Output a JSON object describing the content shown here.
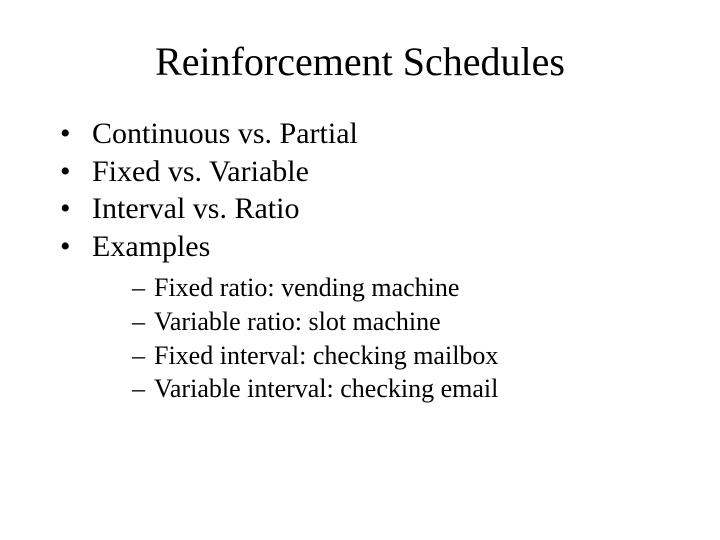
{
  "title": "Reinforcement Schedules",
  "bullets": {
    "0": "Continuous vs. Partial",
    "1": "Fixed vs. Variable",
    "2": "Interval vs. Ratio",
    "3": "Examples"
  },
  "sub_bullets": {
    "0": "Fixed ratio: vending machine",
    "1": "Variable ratio: slot machine",
    "2": "Fixed interval:  checking mailbox",
    "3": "Variable interval:  checking email"
  }
}
